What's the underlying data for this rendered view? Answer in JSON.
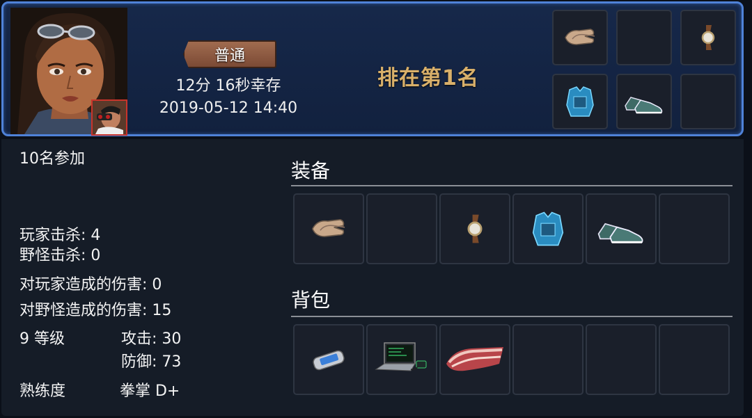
{
  "header": {
    "mode_badge": "普通",
    "survival_time": "12分 16秒幸存",
    "datetime": "2019-05-12 14:40",
    "rank_text": "排在第1名"
  },
  "top_equipment_slots": [
    {
      "icon": "gloves-icon"
    },
    {
      "icon": "empty-slot"
    },
    {
      "icon": "wristwatch-icon"
    },
    {
      "icon": "armor-vest-icon"
    },
    {
      "icon": "sneakers-icon"
    },
    {
      "icon": "empty-slot"
    }
  ],
  "stats": {
    "participants": "10名参加",
    "player_kills": "玩家击杀: 4",
    "monster_kills": "野怪击杀: 0",
    "damage_to_players": "对玩家造成的伤害: 0",
    "damage_to_monsters": "对野怪造成的伤害: 15",
    "level": "9 等级",
    "attack": "攻击: 30",
    "defense": "防御: 73",
    "proficiency_label": "熟练度",
    "proficiency_value": "拳掌 D+"
  },
  "equipment": {
    "title": "装备",
    "slots": [
      {
        "icon": "gloves-icon"
      },
      {
        "icon": "empty-slot"
      },
      {
        "icon": "wristwatch-icon"
      },
      {
        "icon": "armor-vest-icon"
      },
      {
        "icon": "sneakers-icon"
      },
      {
        "icon": "empty-slot"
      }
    ]
  },
  "backpack": {
    "title": "背包",
    "slots": [
      {
        "icon": "pager-device-icon"
      },
      {
        "icon": "laptop-icon"
      },
      {
        "icon": "raw-meat-icon"
      },
      {
        "icon": "empty-slot"
      },
      {
        "icon": "empty-slot"
      },
      {
        "icon": "empty-slot"
      }
    ]
  },
  "colors": {
    "card_border": "#4f82d8",
    "rank_gold": "#d9b06a",
    "badge_brown": "#8a5a42",
    "panel_bg": "#151c27"
  }
}
